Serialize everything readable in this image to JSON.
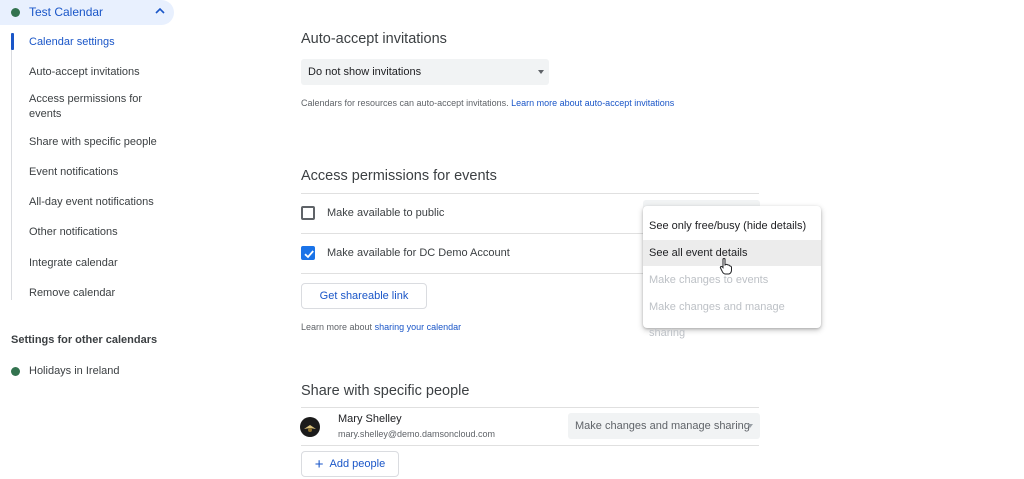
{
  "sidebar": {
    "calendar_name": "Test Calendar",
    "calendar_color": "#33734f",
    "items": [
      {
        "label": "Calendar settings",
        "active": true
      },
      {
        "label": "Auto-accept invitations"
      },
      {
        "label": "Access permissions for events"
      },
      {
        "label": "Share with specific people"
      },
      {
        "label": "Event notifications"
      },
      {
        "label": "All-day event notifications"
      },
      {
        "label": "Other notifications"
      },
      {
        "label": "Integrate calendar"
      },
      {
        "label": "Remove calendar"
      }
    ],
    "other_title": "Settings for other calendars",
    "other_calendars": [
      {
        "label": "Holidays in Ireland",
        "color": "#33734f"
      }
    ]
  },
  "auto_accept": {
    "title": "Auto-accept invitations",
    "select_value": "Do not show invitations",
    "help_text": "Calendars for resources can auto-accept invitations.",
    "help_link": "Learn more about auto-accept invitations"
  },
  "access": {
    "title": "Access permissions for events",
    "public_label": "Make available to public",
    "public_checked": false,
    "account_label": "Make available for DC Demo Account",
    "account_checked": true,
    "shareable_button": "Get shareable link",
    "learn_text": "Learn more about",
    "learn_link": "sharing your calendar"
  },
  "menu": {
    "items": [
      {
        "label": "See only free/busy (hide details)",
        "state": "enabled"
      },
      {
        "label": "See all event details",
        "state": "hover"
      },
      {
        "label": "Make changes to events",
        "state": "disabled"
      },
      {
        "label": "Make changes and manage sharing",
        "state": "disabled"
      }
    ]
  },
  "share": {
    "title": "Share with specific people",
    "person_name": "Mary Shelley",
    "person_email": "mary.shelley@demo.damsoncloud.com",
    "permission": "Make changes and manage sharing",
    "add_button": "Add people"
  },
  "colors": {
    "accent": "#1a56c8",
    "checkbox": "#1a73e8",
    "highlight_bg": "#e8f0fe"
  }
}
